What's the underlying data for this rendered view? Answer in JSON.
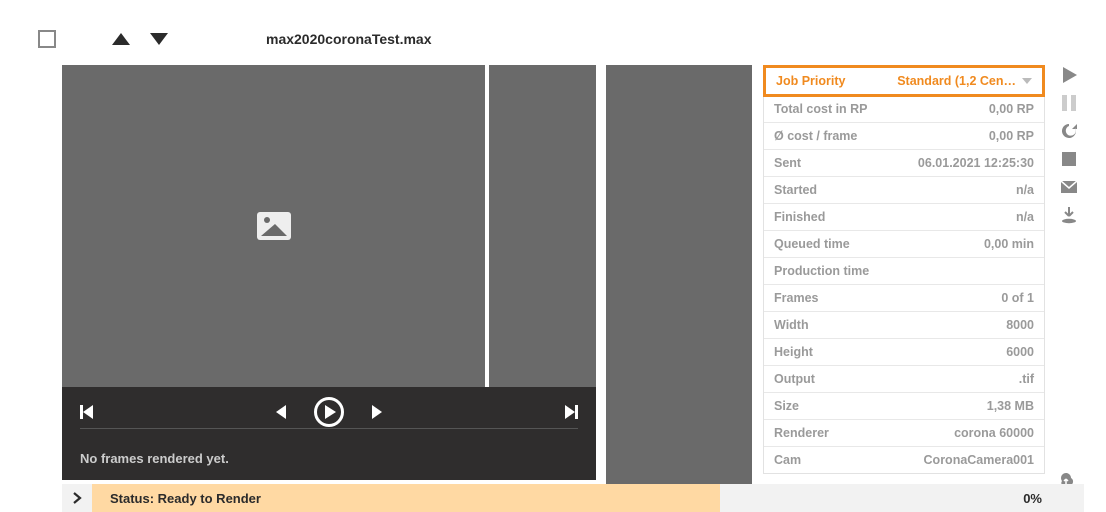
{
  "header": {
    "filename": "max2020coronaTest.max"
  },
  "player": {
    "no_frames_msg": "No frames rendered yet."
  },
  "info": {
    "priority_label": "Job Priority",
    "priority_value": "Standard (1,2 Cen…",
    "rows": [
      {
        "label": "Total cost in RP",
        "value": "0,00 RP"
      },
      {
        "label": "Ø cost / frame",
        "value": "0,00 RP"
      },
      {
        "label": "Sent",
        "value": "06.01.2021 12:25:30"
      },
      {
        "label": "Started",
        "value": "n/a"
      },
      {
        "label": "Finished",
        "value": "n/a"
      },
      {
        "label": "Queued time",
        "value": "0,00 min"
      },
      {
        "label": "Production time",
        "value": ""
      },
      {
        "label": "Frames",
        "value": "0 of 1"
      },
      {
        "label": "Width",
        "value": "8000"
      },
      {
        "label": "Height",
        "value": "6000"
      },
      {
        "label": "Output",
        "value": ".tif"
      },
      {
        "label": "Size",
        "value": "1,38 MB"
      },
      {
        "label": "Renderer",
        "value": "corona 60000"
      },
      {
        "label": "Cam",
        "value": "CoronaCamera001"
      }
    ]
  },
  "status": {
    "text": "Status: Ready to Render",
    "percent": "0%"
  }
}
